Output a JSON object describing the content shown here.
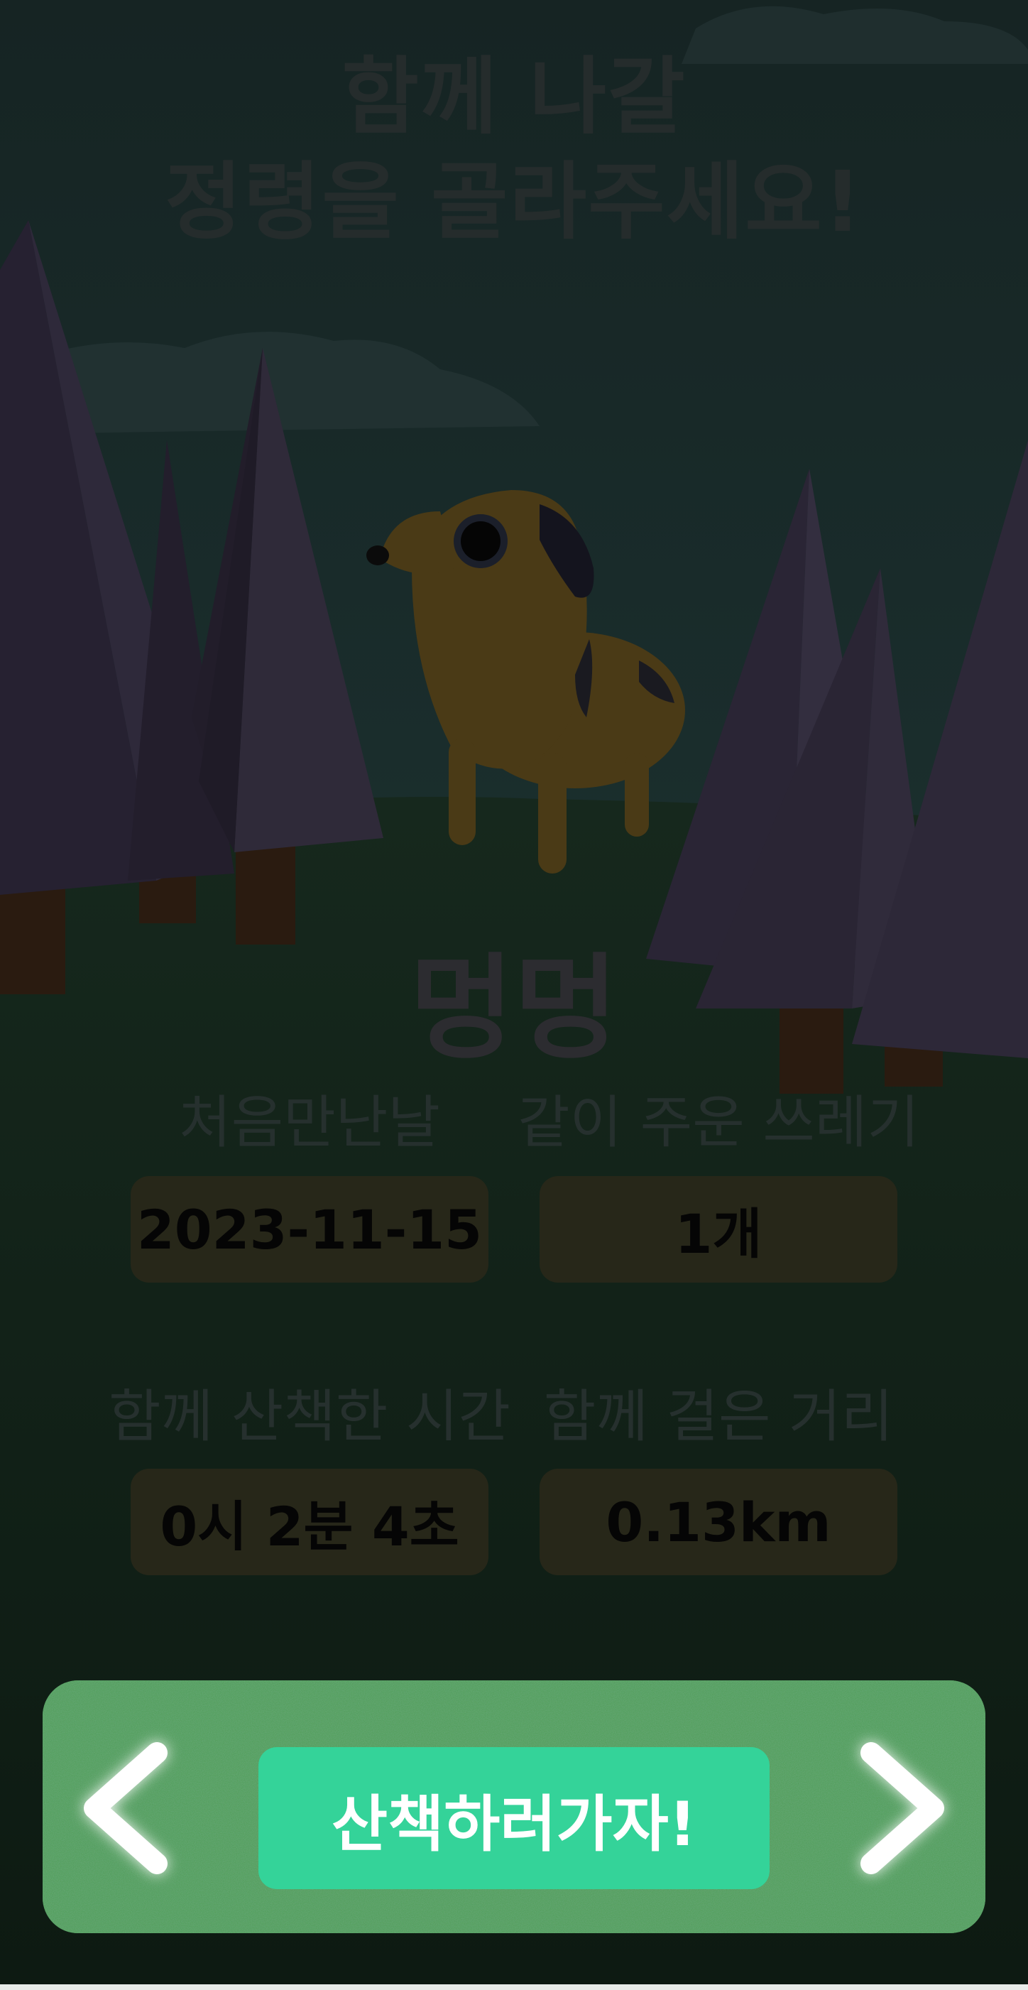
{
  "header": {
    "title_line1": "함께 나갈",
    "title_line2": "정령을 골라주세요!"
  },
  "companion": {
    "name": "멍멍"
  },
  "stats": [
    {
      "label": "처음만난날",
      "value": "2023-11-15"
    },
    {
      "label": "같이 주운 쓰레기",
      "value": "1개"
    },
    {
      "label": "함께 산책한 시간",
      "value": "0시 2분 4초"
    },
    {
      "label": "함께 걸은 거리",
      "value": "0.13km"
    }
  ],
  "actions": {
    "walk_label": "산책하러가자!",
    "prev_icon": "chevron-left-icon",
    "next_icon": "chevron-right-icon"
  },
  "colors": {
    "accent": "#34d399",
    "panel": "#4e9a56",
    "overlay": "#0e1616"
  }
}
